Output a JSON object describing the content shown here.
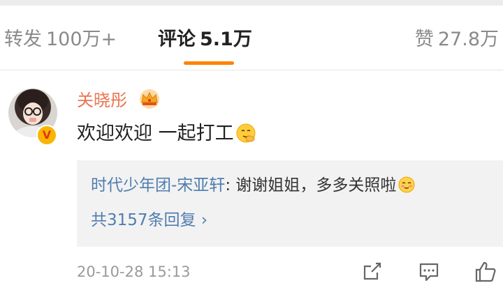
{
  "tabs": {
    "forward": {
      "label": "转发",
      "count": "100万+"
    },
    "comment": {
      "label": "评论",
      "count": "5.1万"
    },
    "like": {
      "label": "赞",
      "count": "27.8万"
    }
  },
  "comment": {
    "username": "关晓彤",
    "verified_badge": "V",
    "text": "欢迎欢迎 一起打工",
    "emoji": "hug-face-emoji",
    "reply": {
      "author": "时代少年团-宋亚轩",
      "separator": ": ",
      "text": "谢谢姐姐，多多关照啦",
      "emoji": "shy-face-emoji",
      "more": "共3157条回复 ›"
    },
    "timestamp": "20-10-28 15:13"
  },
  "colors": {
    "accent": "#ff8200",
    "username": "#eb7350",
    "link": "#507daf"
  }
}
